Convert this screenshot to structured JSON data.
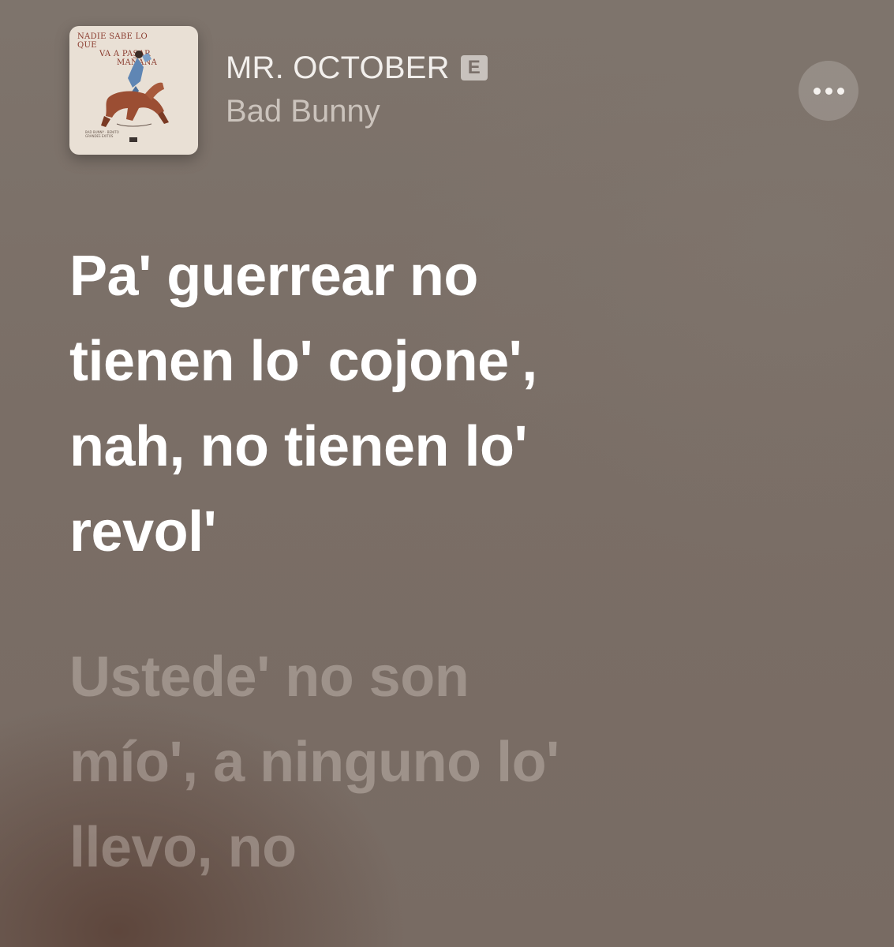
{
  "track": {
    "title": "MR. OCTOBER",
    "explicit_badge": "E",
    "artist": "Bad Bunny"
  },
  "artwork": {
    "title_lines": [
      "NADIE SABE LO QUE",
      "VA A PASAR",
      "MAÑANA"
    ],
    "sub_lines": [
      "BAD BUNNY · BENITO",
      "GRANDES EXITOS"
    ]
  },
  "more_button": {
    "icon": "ellipsis-icon"
  },
  "lyrics": {
    "active_lines": [
      "Pa' guerrear no",
      "tienen lo' cojone',",
      "nah, no tienen lo'",
      "revol'"
    ],
    "next_lines": [
      "Ustede' no son",
      "mío', a ninguno lo'",
      "llevo, no"
    ]
  },
  "colors": {
    "background": "#7b6f67",
    "active_lyric": "#ffffff",
    "inactive_lyric": "rgba(235,228,222,0.32)"
  }
}
